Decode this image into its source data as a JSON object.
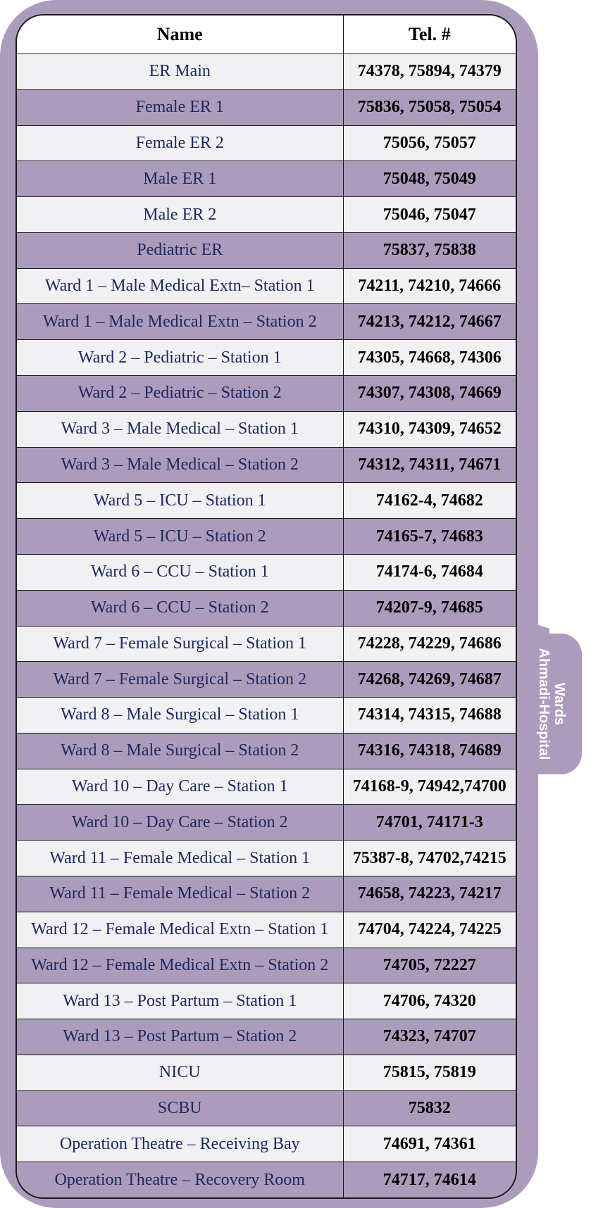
{
  "tab": {
    "line1": "Wards",
    "line2": "Ahmadi-Hospital"
  },
  "headers": {
    "name": "Name",
    "tel": "Tel. #"
  },
  "rows": [
    {
      "name": "ER Main",
      "tel": "74378, 75894, 74379"
    },
    {
      "name": "Female ER 1",
      "tel": "75836, 75058, 75054"
    },
    {
      "name": "Female ER 2",
      "tel": "75056, 75057"
    },
    {
      "name": "Male ER 1",
      "tel": "75048, 75049"
    },
    {
      "name": "Male ER 2",
      "tel": "75046, 75047"
    },
    {
      "name": "Pediatric ER",
      "tel": "75837, 75838"
    },
    {
      "name": "Ward 1 – Male Medical Extn– Station 1",
      "tel": "74211, 74210, 74666"
    },
    {
      "name": "Ward 1 – Male Medical Extn – Station 2",
      "tel": "74213, 74212, 74667"
    },
    {
      "name": "Ward 2 – Pediatric – Station 1",
      "tel": "74305, 74668, 74306"
    },
    {
      "name": "Ward 2 – Pediatric – Station 2",
      "tel": "74307, 74308, 74669"
    },
    {
      "name": "Ward 3 – Male Medical – Station 1",
      "tel": "74310, 74309, 74652"
    },
    {
      "name": "Ward 3 – Male Medical – Station 2",
      "tel": "74312, 74311, 74671"
    },
    {
      "name": "Ward 5 – ICU – Station 1",
      "tel": "74162-4, 74682"
    },
    {
      "name": "Ward 5 – ICU – Station 2",
      "tel": "74165-7, 74683"
    },
    {
      "name": "Ward 6 – CCU – Station 1",
      "tel": "74174-6, 74684"
    },
    {
      "name": "Ward 6 – CCU – Station 2",
      "tel": "74207-9, 74685"
    },
    {
      "name": "Ward 7 – Female Surgical – Station 1",
      "tel": "74228, 74229, 74686"
    },
    {
      "name": "Ward 7 – Female Surgical – Station 2",
      "tel": "74268, 74269, 74687"
    },
    {
      "name": "Ward 8 – Male Surgical – Station 1",
      "tel": "74314, 74315, 74688"
    },
    {
      "name": "Ward 8 – Male Surgical – Station 2",
      "tel": "74316, 74318, 74689"
    },
    {
      "name": "Ward 10 – Day Care – Station 1",
      "tel": "74168-9, 74942,74700"
    },
    {
      "name": "Ward 10 – Day Care – Station 2",
      "tel": "74701, 74171-3"
    },
    {
      "name": "Ward 11 – Female Medical – Station 1",
      "tel": "75387-8, 74702,74215"
    },
    {
      "name": "Ward 11 – Female Medical – Station 2",
      "tel": "74658, 74223, 74217"
    },
    {
      "name": "Ward 12 – Female Medical Extn – Station 1",
      "tel": "74704, 74224, 74225"
    },
    {
      "name": "Ward 12 – Female Medical Extn – Station 2",
      "tel": "74705, 72227"
    },
    {
      "name": "Ward 13 – Post Partum – Station 1",
      "tel": "74706, 74320"
    },
    {
      "name": "Ward 13 – Post Partum – Station 2",
      "tel": "74323, 74707"
    },
    {
      "name": "NICU",
      "tel": "75815, 75819"
    },
    {
      "name": "SCBU",
      "tel": "75832"
    },
    {
      "name": "Operation Theatre – Receiving Bay",
      "tel": "74691, 74361"
    },
    {
      "name": "Operation Theatre – Recovery Room",
      "tel": "74717, 74614"
    }
  ]
}
